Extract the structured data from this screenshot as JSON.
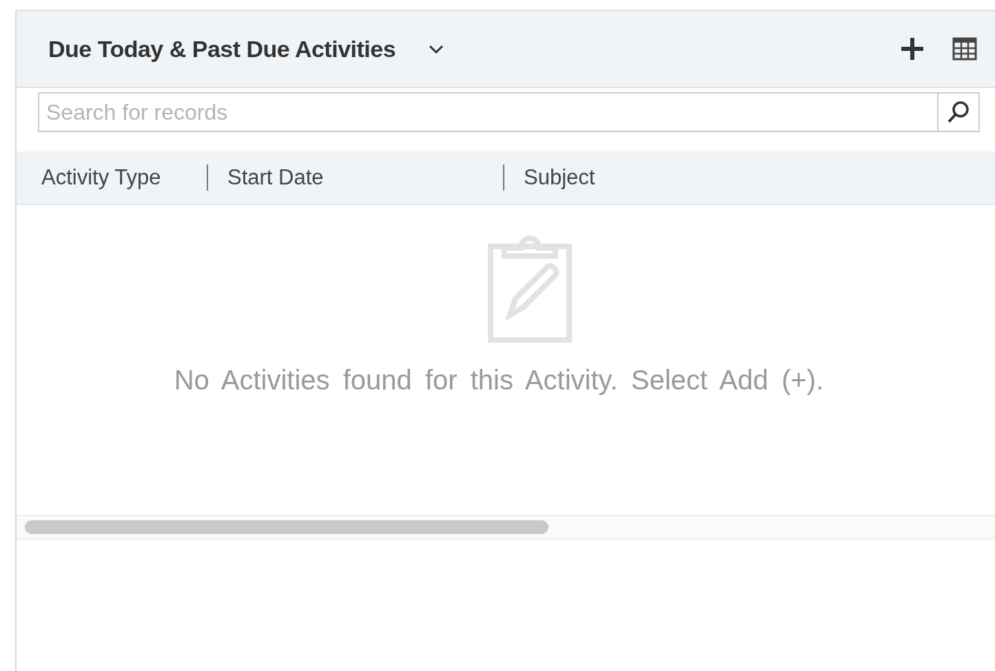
{
  "panel": {
    "title": "Due Today & Past Due Activities"
  },
  "search": {
    "placeholder": "Search for records"
  },
  "table": {
    "columns": [
      "Activity Type",
      "Start Date",
      "Subject"
    ]
  },
  "empty_state": {
    "message": "No Activities found for this Activity. Select Add (+)."
  }
}
